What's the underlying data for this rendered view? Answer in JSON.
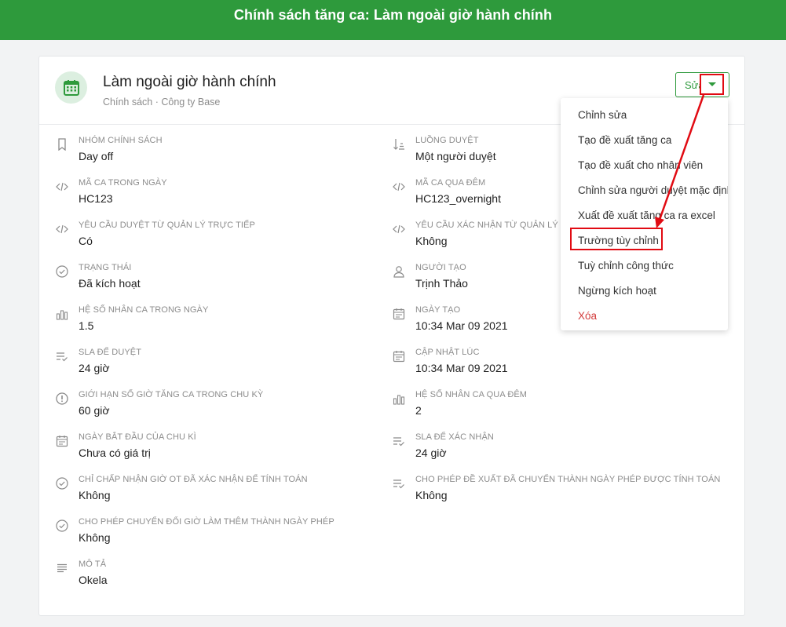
{
  "page": {
    "title": "Chính sách tăng ca: Làm ngoài giờ hành chính"
  },
  "header": {
    "name": "Làm ngoài giờ hành chính",
    "subtitle": "Chính sách · Công ty Base",
    "edit_label": "Sửa"
  },
  "left_fields": [
    {
      "icon": "bookmark-icon",
      "label": "Nhóm chính sách",
      "value": "Day off"
    },
    {
      "icon": "code-icon",
      "label": "Mã ca trong ngày",
      "value": "HC123"
    },
    {
      "icon": "code-icon",
      "label": "Yêu cầu duyệt từ quản lý trực tiếp",
      "value": "Có"
    },
    {
      "icon": "check-circle-icon",
      "label": "Trạng thái",
      "value": "Đã kích hoạt"
    },
    {
      "icon": "bar-chart-icon",
      "label": "Hệ số nhân ca trong ngày",
      "value": "1.5"
    },
    {
      "icon": "list-check-icon",
      "label": "SLA để duyệt",
      "value": "24 giờ"
    },
    {
      "icon": "alert-circle-icon",
      "label": "Giới hạn số giờ tăng ca trong chu kỳ",
      "value": "60 giờ"
    },
    {
      "icon": "calendar-icon",
      "label": "Ngày bắt đầu của chu kì",
      "value": "Chưa có giá trị"
    },
    {
      "icon": "check-circle-icon",
      "label": "Chỉ chấp nhận giờ OT đã xác nhận để tính toán",
      "value": "Không"
    },
    {
      "icon": "check-circle-icon",
      "label": "Cho phép chuyển đổi giờ làm thêm thành ngày phép",
      "value": "Không"
    },
    {
      "icon": "text-lines-icon",
      "label": "Mô tả",
      "value": "Okela"
    }
  ],
  "right_fields": [
    {
      "icon": "sort-icon",
      "label": "Luồng duyệt",
      "value": "Một người duyệt"
    },
    {
      "icon": "code-icon",
      "label": "Mã ca qua đêm",
      "value": "HC123_overnight"
    },
    {
      "icon": "code-icon",
      "label": "Yêu cầu xác nhận từ quản lý trực tiếp",
      "value": "Không"
    },
    {
      "icon": "user-icon",
      "label": "Người tạo",
      "value": "Trịnh Thảo"
    },
    {
      "icon": "calendar-icon",
      "label": "Ngày tạo",
      "value": "10:34 Mar 09 2021"
    },
    {
      "icon": "calendar-icon",
      "label": "Cập nhật lúc",
      "value": "10:34 Mar 09 2021"
    },
    {
      "icon": "bar-chart-icon",
      "label": "Hệ số nhân ca qua đêm",
      "value": "2"
    },
    {
      "icon": "list-check-icon",
      "label": "SLA để xác nhận",
      "value": "24 giờ"
    },
    {
      "icon": "list-check-icon",
      "label": "Cho phép đề xuất đã chuyển thành ngày phép được tính toán",
      "value": "Không"
    }
  ],
  "menu": {
    "items": [
      {
        "label": "Chỉnh sửa"
      },
      {
        "label": "Tạo đề xuất tăng ca"
      },
      {
        "label": "Tạo đề xuất cho nhân viên"
      },
      {
        "label": "Chỉnh sửa người duyệt mặc định"
      },
      {
        "label": "Xuất đề xuất tăng ca ra excel"
      },
      {
        "label": "Trường tùy chỉnh"
      },
      {
        "label": "Tuỳ chỉnh công thức"
      },
      {
        "label": "Ngừng kích hoạt"
      },
      {
        "label": "Xóa"
      }
    ]
  },
  "colors": {
    "brand": "#2e9a3c",
    "annotation": "#e10b13",
    "danger": "#d23a3a"
  }
}
